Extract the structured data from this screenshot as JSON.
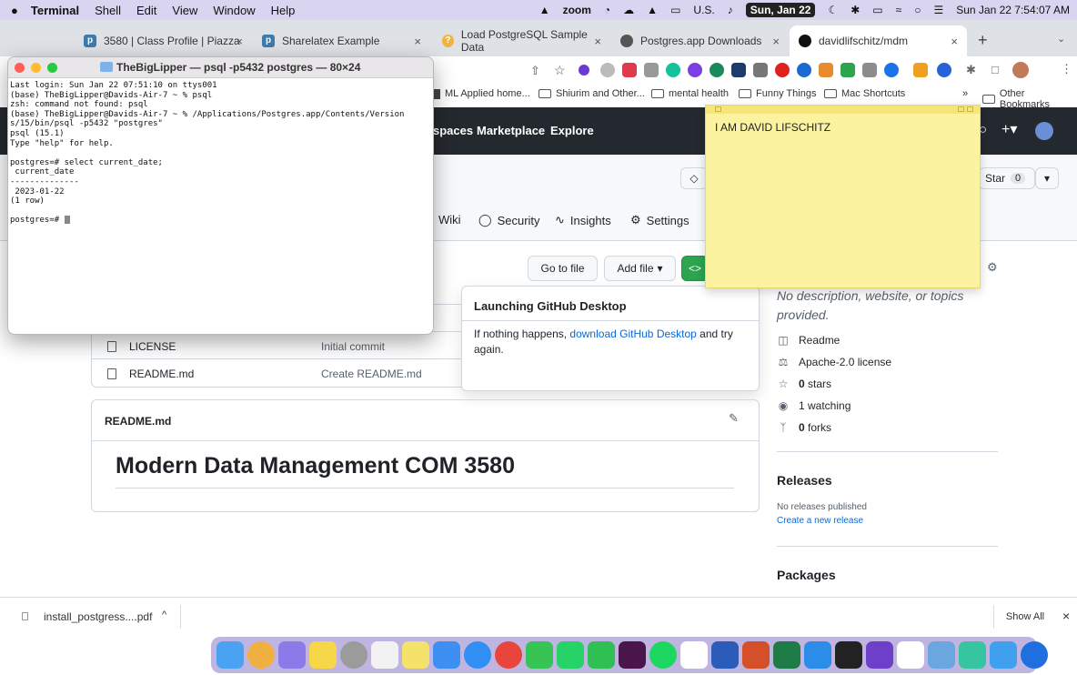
{
  "menubar": {
    "app": "Terminal",
    "items": [
      "Shell",
      "Edit",
      "View",
      "Window",
      "Help"
    ],
    "zoom": "zoom",
    "input_source": "U.S.",
    "date_pill": "Sun, Jan 22",
    "clock": "Sun Jan 22  7:54:07 AM"
  },
  "browser": {
    "tabs": [
      {
        "title": "3580 | Class Profile | Piazza"
      },
      {
        "title": "Sharelatex Example"
      },
      {
        "title": "Load PostgreSQL Sample Data"
      },
      {
        "title": "Postgres.app Downloads"
      },
      {
        "title": "davidlifschitz/mdm"
      }
    ],
    "bookmarks": [
      "ML Applied home...",
      "Shiurim and Other...",
      "mental health",
      "Funny Things",
      "Mac Shortcuts"
    ],
    "other_bookmarks": "Other Bookmarks"
  },
  "github": {
    "nav": [
      "spaces",
      "Marketplace",
      "Explore"
    ],
    "star_label": "Star",
    "star_count": "0",
    "repo_tabs": [
      "Wiki",
      "Security",
      "Insights",
      "Settings"
    ],
    "goto_file": "Go to file",
    "add_file": "Add file",
    "popup": {
      "title": "Launching GitHub Desktop",
      "body_prefix": "If nothing happens, ",
      "link": "download GitHub Desktop",
      "body_suffix": " and try again."
    },
    "files": [
      {
        "name": "LICENSE",
        "message": "Initial commit"
      },
      {
        "name": "README.md",
        "message": "Create README.md"
      }
    ],
    "readme_label": "README.md",
    "readme_heading": "Modern Data Management COM 3580",
    "about": {
      "description": "No description, website, or topics provided.",
      "readme": "Readme",
      "license": "Apache-2.0 license",
      "stars_count": "0",
      "stars_label": "stars",
      "watching": "1 watching",
      "forks_count": "0",
      "forks_label": "forks"
    },
    "releases": {
      "title": "Releases",
      "none": "No releases published",
      "create": "Create a new release"
    },
    "packages_title": "Packages"
  },
  "terminal": {
    "title": "TheBigLipper — psql -p5432 postgres — 80×24",
    "lines": [
      "Last login: Sun Jan 22 07:51:10 on ttys001",
      "(base) TheBigLipper@Davids-Air-7 ~ % psql",
      "zsh: command not found: psql",
      "(base) TheBigLipper@Davids-Air-7 ~ % /Applications/Postgres.app/Contents/Version",
      "s/15/bin/psql -p5432 \"postgres\"",
      "psql (15.1)",
      "Type \"help\" for help.",
      "",
      "postgres=# select current_date;",
      " current_date",
      "--------------",
      " 2023-01-22",
      "(1 row)",
      "",
      "postgres=# "
    ]
  },
  "sticky": {
    "text": "I AM DAVID LIFSCHITZ"
  },
  "download": {
    "file": "install_postgress....pdf",
    "show_all": "Show All"
  }
}
